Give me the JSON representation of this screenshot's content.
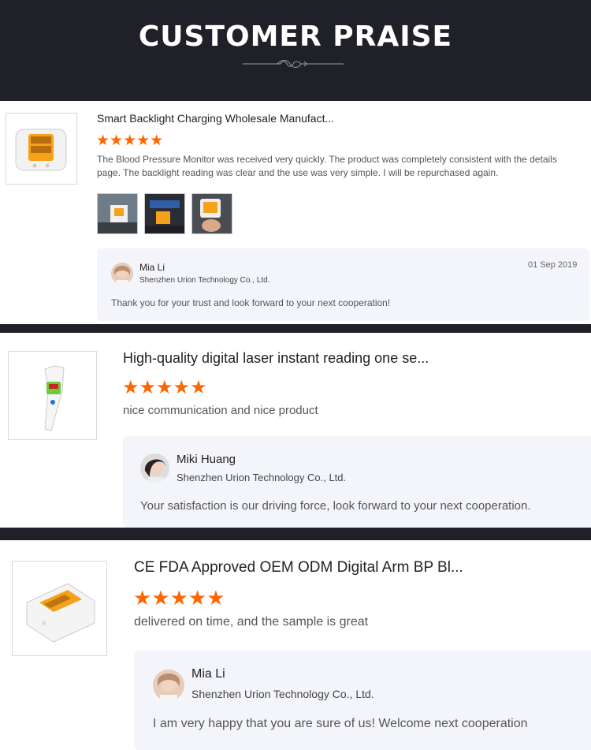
{
  "header": {
    "title": "CUSTOMER PRAISE"
  },
  "colors": {
    "dark_bg": "#202028",
    "star": "#ff6600",
    "reply_bg": "#f4f5fa"
  },
  "reviews": [
    {
      "product_title": "Smart Backlight Charging Wholesale Manufact...",
      "rating": 5,
      "stars": "★★★★★",
      "text": "The Blood Pressure Monitor was received very quickly. The product was completely consistent with the details page. The backlight reading was clear and the use was very simple. I will be repurchased again.",
      "photos": [
        "review-photo-1",
        "review-photo-2",
        "review-photo-3"
      ],
      "reply": {
        "name": "Mia Li",
        "company": "Shenzhen Urion Technology Co., Ltd.",
        "date": "01 Sep 2019",
        "text": "Thank you for your trust and look forward to your next cooperation!"
      }
    },
    {
      "product_title": "High-quality digital laser instant reading one se...",
      "rating": 5,
      "stars": "★★★★★",
      "text": "nice communication and nice product",
      "reply": {
        "name": "Miki Huang",
        "company": "Shenzhen Urion Technology Co., Ltd.",
        "text": "Your satisfaction is our driving force, look forward to your next cooperation."
      }
    },
    {
      "product_title": "CE FDA Approved OEM ODM Digital Arm BP Bl...",
      "rating": 5,
      "stars": "★★★★★",
      "text": "delivered on time, and the sample is great",
      "reply": {
        "name": "Mia Li",
        "company": "Shenzhen Urion Technology Co., Ltd.",
        "text": "I am very happy that you are sure of us! Welcome next cooperation"
      }
    }
  ]
}
